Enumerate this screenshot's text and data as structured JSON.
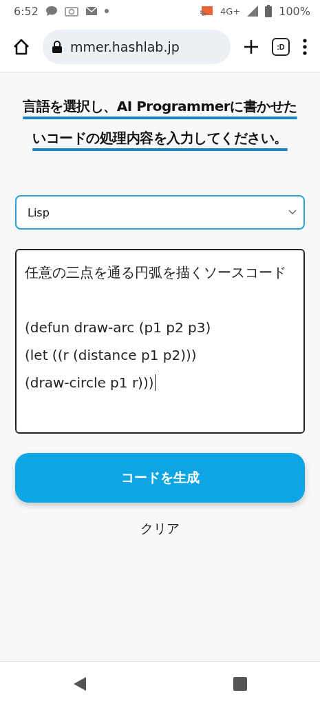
{
  "status_bar": {
    "time": "6:52",
    "network": "4G+",
    "battery": "100%"
  },
  "browser": {
    "url": "mmer.hashlab.jp",
    "tab_counter": ":D"
  },
  "heading": "言語を選択し、AI Programmerに書かせたいコードの処理内容を入力してください。",
  "language_select": {
    "value": "Lisp"
  },
  "prompt_field": {
    "value": "任意の三点を通る円弧を描くソースコード\n\n(defun draw-arc (p1 p2 p3)\n(let ((r (distance p1 p2)))\n(draw-circle p1 r)))"
  },
  "buttons": [
    {
      "kind": "primary",
      "label": "コードを生成"
    },
    {
      "kind": "text",
      "label": "クリア"
    }
  ]
}
